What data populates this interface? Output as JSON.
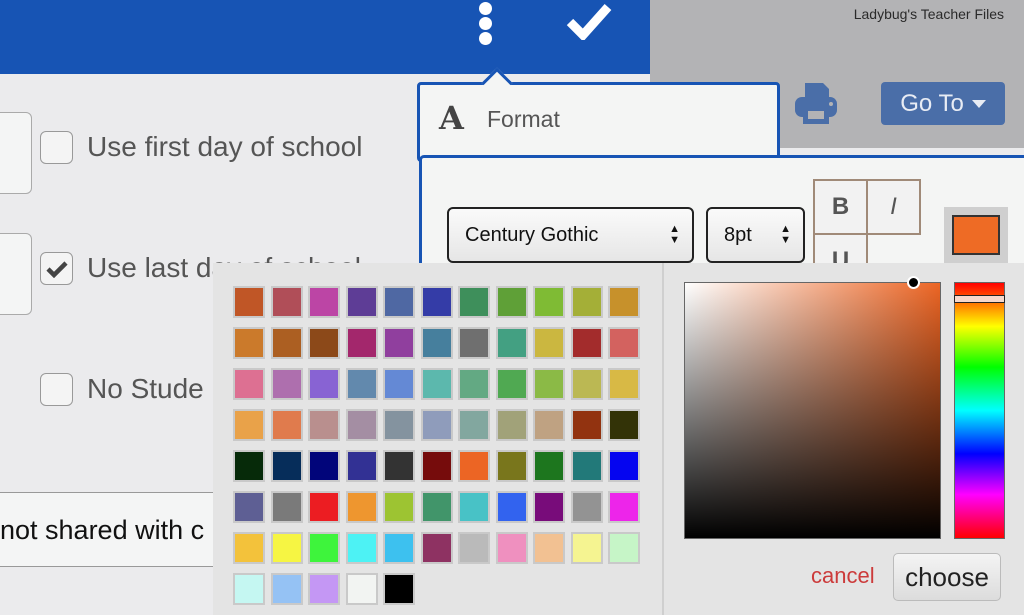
{
  "header": {
    "more_icon": "kebab-vertical-icon",
    "confirm_icon": "checkmark-icon",
    "brand": "Ladybug's Teacher Files",
    "goto_label": "Go To",
    "print_icon": "printer-icon"
  },
  "options": [
    {
      "label": "Use first day of school",
      "checked": false
    },
    {
      "label": "Use last day of school",
      "checked": true
    },
    {
      "label": "No Stude",
      "checked": false
    }
  ],
  "shared_field_value": "not shared with c",
  "format": {
    "title": "Format",
    "title_icon": "A",
    "font_value": "Century Gothic",
    "size_value": "8pt",
    "bold_label": "B",
    "italic_label": "I",
    "underline_label": "U",
    "current_color": "#ee6b25"
  },
  "palette": {
    "swatches": [
      "#c05626",
      "#b04e58",
      "#bc45a5",
      "#5e3d96",
      "#4f68a3",
      "#343ca7",
      "#3e8f5b",
      "#5fa037",
      "#7fbb34",
      "#a4af37",
      "#c7912b",
      "#cb7a2b",
      "#ac5f22",
      "#8c4919",
      "#a3276c",
      "#903f9e",
      "#467f9d",
      "#6f6f6f",
      "#43a082",
      "#cbb740",
      "#a32c2c",
      "#d3625f",
      "#dd7092",
      "#ae6fae",
      "#8863d3",
      "#6289ad",
      "#6489d5",
      "#5cb8ad",
      "#63a983",
      "#50a952",
      "#8bba46",
      "#bbb853",
      "#d8b945",
      "#e9a249",
      "#e07b4d",
      "#b98f8e",
      "#a48ea3",
      "#84939f",
      "#8f9cbb",
      "#82a79f",
      "#a1a279",
      "#bfa282",
      "#923310",
      "#333307",
      "#062a09",
      "#062d5a",
      "#01057a",
      "#323194",
      "#333333",
      "#760c0c",
      "#ec6524",
      "#79761c",
      "#1d761e",
      "#227979",
      "#0505f0",
      "#5e5f94",
      "#7a7a7a",
      "#ec1d22",
      "#ee962f",
      "#9dc432",
      "#41956a",
      "#48c2c6",
      "#3263ef",
      "#780c7a",
      "#939393",
      "#ed25ea",
      "#f3c23b",
      "#f6f543",
      "#3ef43c",
      "#4df2f4",
      "#3dc1ef",
      "#8e3262",
      "#bababa",
      "#ef90bf",
      "#f2c192",
      "#f5f491",
      "#c6f5c7",
      "#c5f7f2",
      "#95c2f4",
      "#c497f4",
      "#f2f4f2",
      "#000000"
    ],
    "picker_hue": "#ec6524",
    "cancel_label": "cancel",
    "choose_label": "choose"
  }
}
